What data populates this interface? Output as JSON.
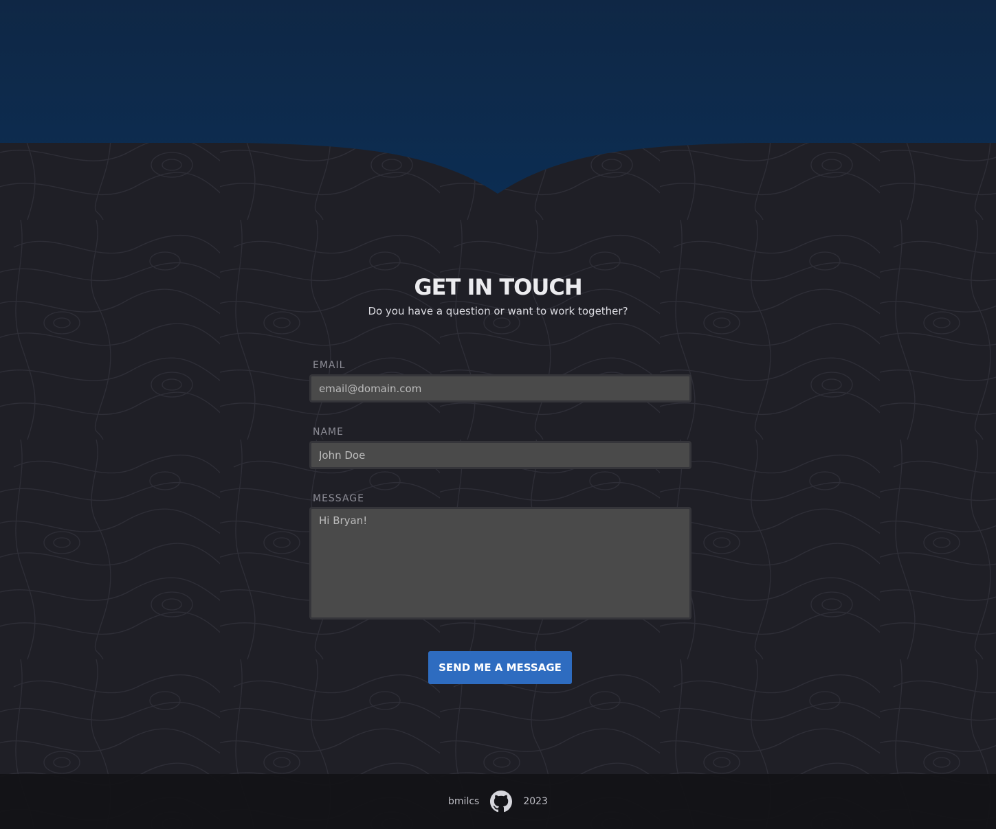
{
  "contact": {
    "title": "GET IN TOUCH",
    "subtitle": "Do you have a question or want to work together?",
    "email_label": "EMAIL",
    "email_placeholder": "email@domain.com",
    "name_label": "NAME",
    "name_placeholder": "John Doe",
    "message_label": "MESSAGE",
    "message_placeholder": "Hi Bryan!",
    "send_label": "SEND ME A MESSAGE"
  },
  "footer": {
    "username": "bmilcs",
    "github_icon": "github-icon",
    "year": "2023"
  },
  "colors": {
    "hero_top": "#0f2745",
    "hero_bottom": "#0c2d52",
    "background": "#1f1f26",
    "accent": "#2e6cc0",
    "input_bg": "#4a4a4a",
    "footer_bg": "#151519"
  }
}
